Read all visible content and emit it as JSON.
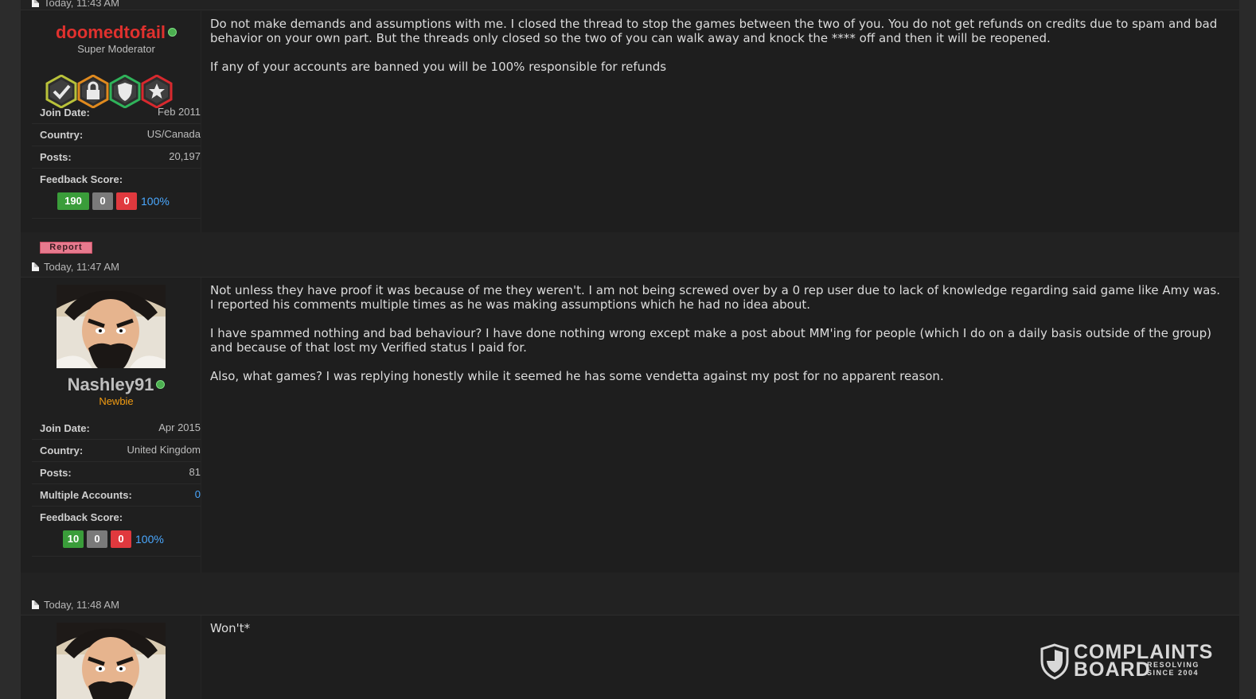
{
  "posts": [
    {
      "date": "Today, 11:43 AM",
      "user": {
        "name": "doomedtofail",
        "title": "Super Moderator",
        "name_color": "#e0312e",
        "title_color": "#bdbdbd",
        "badges": [
          "check-badge-icon",
          "lock-badge-icon",
          "shield-badge-icon",
          "star-badge-icon"
        ],
        "stats": [
          {
            "label": "Join Date:",
            "value": "Feb 2011"
          },
          {
            "label": "Country:",
            "value": "US/Canada"
          },
          {
            "label": "Posts:",
            "value": "20,197"
          }
        ],
        "feedback_label": "Feedback Score:",
        "feedback": {
          "positive": "190",
          "neutral": "0",
          "negative": "0",
          "percent": "100%"
        }
      },
      "paragraphs": [
        "Do not make demands and assumptions with me. I closed the thread to stop the games between the two of you. You do not get refunds on credits due to spam and bad behavior on your own part. But the threads only closed so the two of you can walk away and knock the **** off and then it will be reopened.",
        "If any of your accounts are banned you will be 100% responsible for refunds"
      ],
      "report_label": "Report"
    },
    {
      "date": "Today, 11:47 AM",
      "user": {
        "name": "Nashley91",
        "title": "Newbie",
        "name_color": "#bfbfbf",
        "title_color": "#f39c12",
        "stats": [
          {
            "label": "Join Date:",
            "value": "Apr 2015"
          },
          {
            "label": "Country:",
            "value": "United Kingdom"
          },
          {
            "label": "Posts:",
            "value": "81"
          },
          {
            "label": "Multiple Accounts:",
            "value": "0"
          }
        ],
        "feedback_label": "Feedback Score:",
        "feedback": {
          "positive": "10",
          "neutral": "0",
          "negative": "0",
          "percent": "100%"
        }
      },
      "paragraphs": [
        "Not unless they have proof it was because of me they weren't. I am not being screwed over by a 0 rep user due to lack of knowledge regarding said game like Amy was. I reported his comments multiple times as he was making assumptions which he had no idea about.",
        "I have spammed nothing and bad behaviour? I have done nothing wrong except make a post about MM'ing for people (which I do on a daily basis outside of the group) and because of that lost my Verified status I paid for.",
        "Also, what games? I was replying honestly while it seemed he has some vendetta against my post for no apparent reason."
      ]
    },
    {
      "date": "Today, 11:48 AM",
      "paragraphs": [
        "Won't*"
      ]
    }
  ],
  "watermark": {
    "line1": "COMPLAINTS",
    "line2": "BOARD",
    "tag1": "RESOLVING",
    "tag2": "SINCE 2004",
    "icon": "shield-icon"
  },
  "colors": {
    "link": "#4aa8ff",
    "feedback_positive": "#3a9d3a",
    "feedback_neutral": "#7a7a7a",
    "feedback_negative": "#e0393e",
    "report": "#e77a8e"
  }
}
